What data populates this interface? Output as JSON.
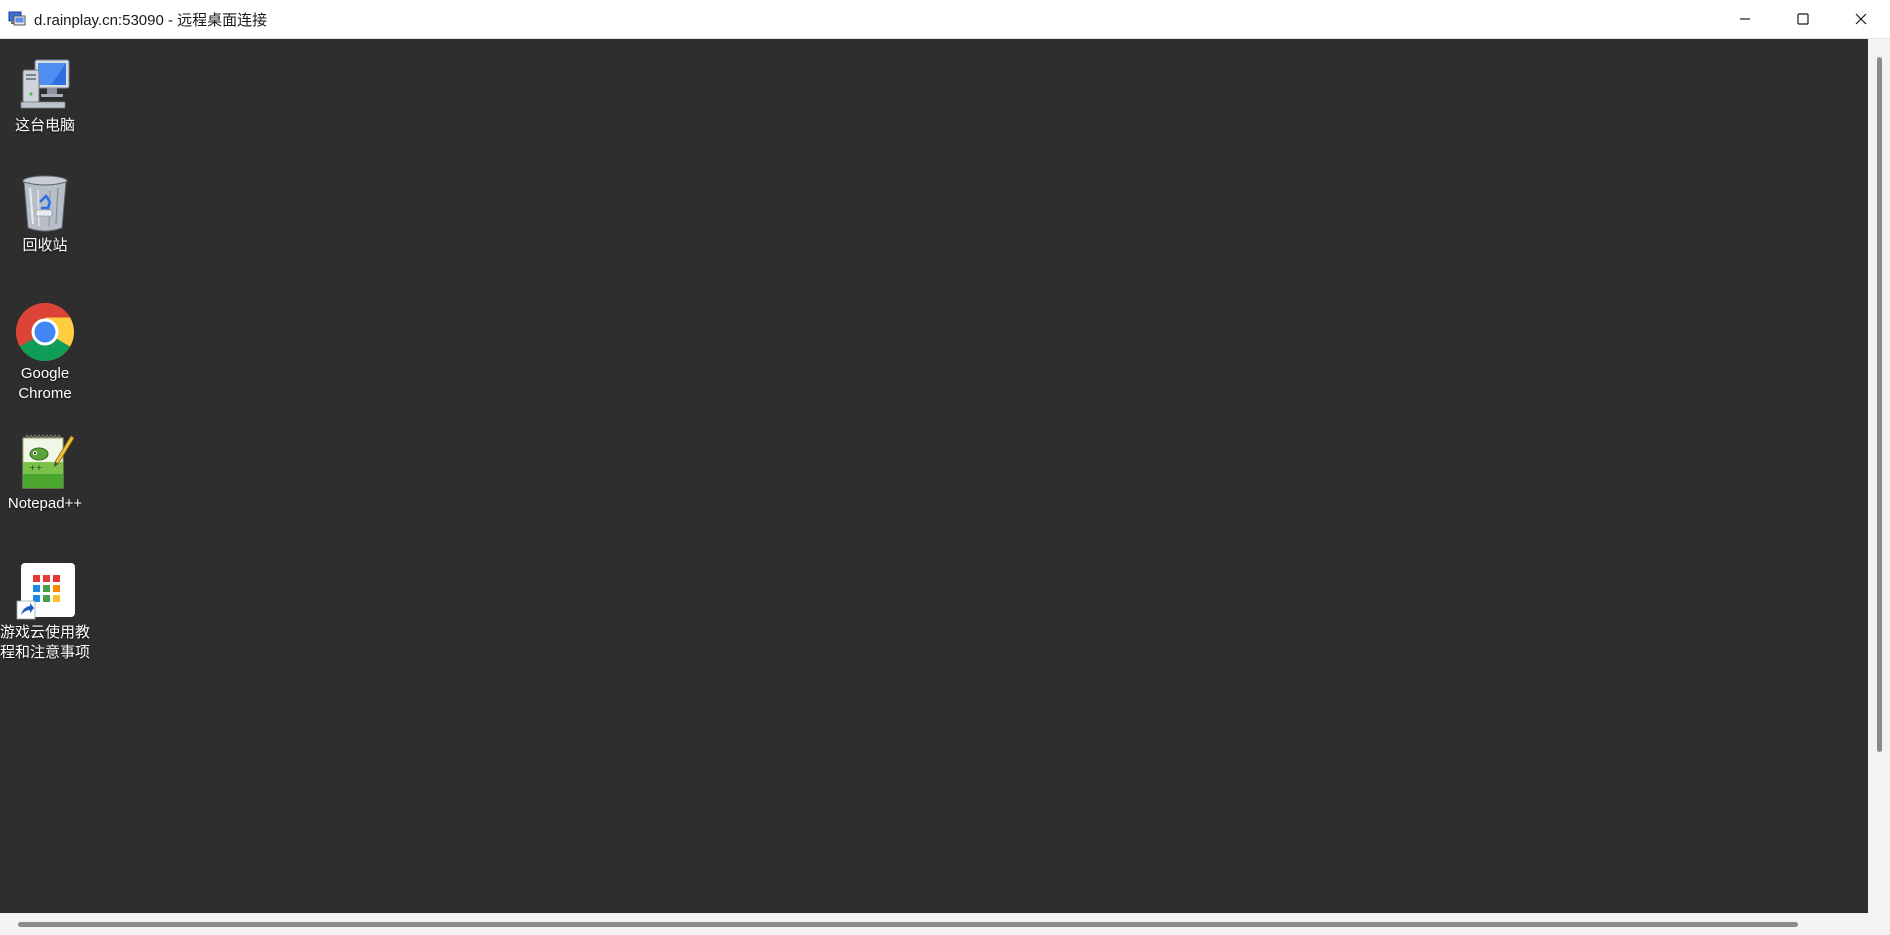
{
  "window": {
    "title": "d.rainplay.cn:53090 - 远程桌面连接",
    "icon": "remote-desktop-icon",
    "controls": [
      "minimize-icon",
      "maximize-icon",
      "close-icon"
    ]
  },
  "desktop": {
    "background": "#2e2e2e",
    "icons": [
      {
        "label": "这台电脑",
        "icon": "computer-icon"
      },
      {
        "label": "回收站",
        "icon": "recycle-bin-icon"
      },
      {
        "label": "Google\nChrome",
        "icon": "chrome-icon"
      },
      {
        "label": "Notepad++",
        "icon": "notepad-plus-plus-icon"
      },
      {
        "label": "游戏云使用教\n程和注意事项",
        "icon": "shortcut-app-grid-icon"
      }
    ]
  }
}
